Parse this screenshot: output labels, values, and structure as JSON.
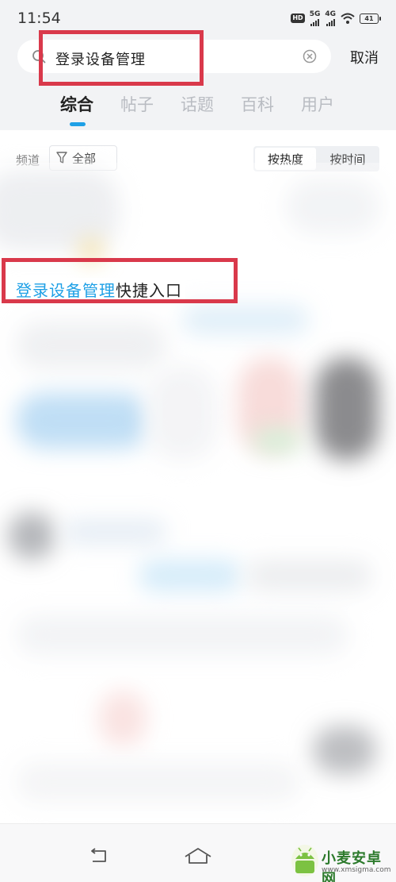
{
  "status_bar": {
    "time": "11:54",
    "hd_label": "HD",
    "net1": "5G",
    "net2": "4G",
    "battery": "41"
  },
  "search": {
    "query": "登录设备管理",
    "cancel_label": "取消"
  },
  "tabs": [
    {
      "label": "综合",
      "active": true
    },
    {
      "label": "帖子",
      "active": false
    },
    {
      "label": "话题",
      "active": false
    },
    {
      "label": "百科",
      "active": false
    },
    {
      "label": "用户",
      "active": false
    }
  ],
  "filter": {
    "channel_label": "频道",
    "channel_value": "全部",
    "sort_hot": "按热度",
    "sort_time": "按时间"
  },
  "result": {
    "title_highlight": "登录设备管理",
    "title_rest": "快捷入口"
  },
  "watermark": {
    "brand": "小麦安卓网",
    "url": "www.xmsigma.com"
  },
  "colors": {
    "accent": "#1ea0e6",
    "annotation_frame": "#d9394b",
    "header_bg": "#f2f3f5"
  },
  "icons": [
    "search-icon",
    "clear-icon",
    "filter-icon",
    "back-nav-icon",
    "home-nav-icon"
  ]
}
